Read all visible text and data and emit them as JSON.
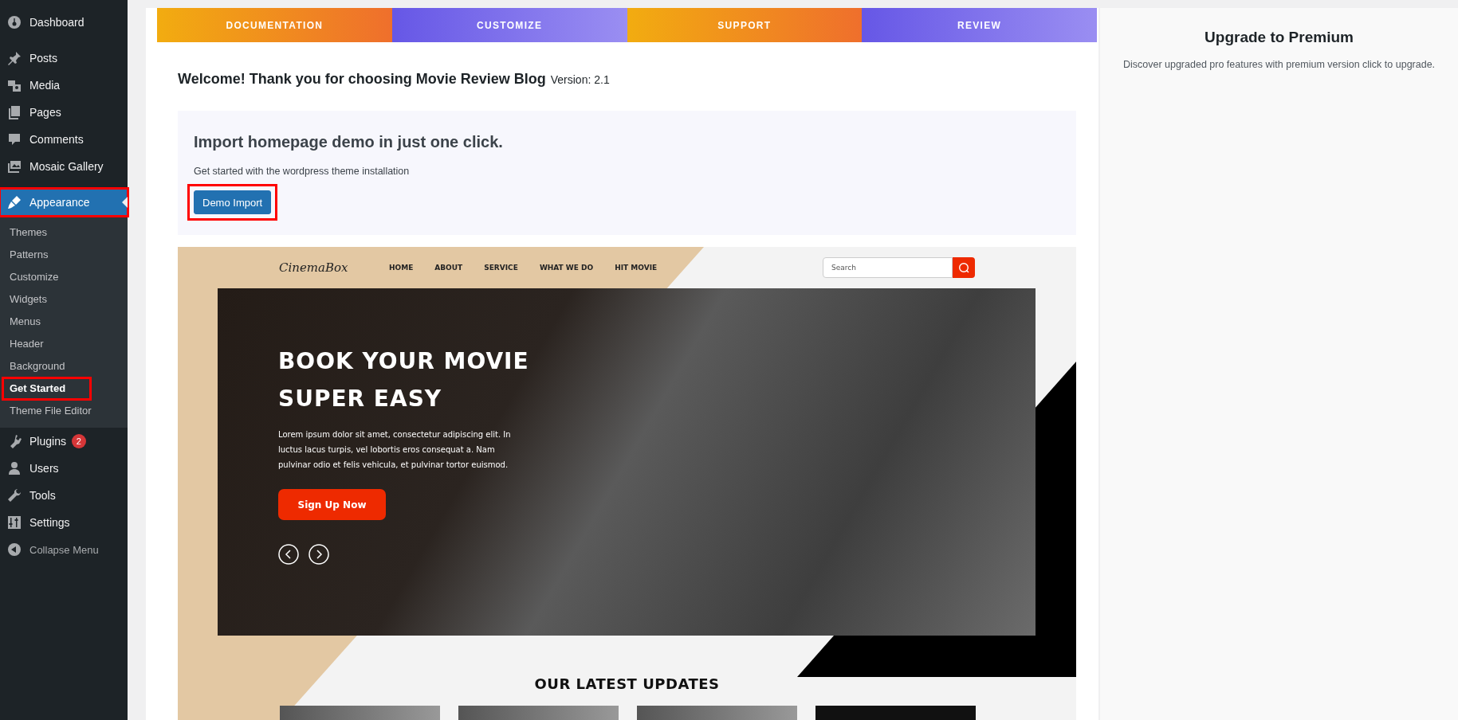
{
  "sidebar": {
    "menu": [
      {
        "label": "Dashboard",
        "selected": false,
        "highlighted": false
      },
      {
        "label": "Posts",
        "selected": false,
        "highlighted": false
      },
      {
        "label": "Media",
        "selected": false,
        "highlighted": false
      },
      {
        "label": "Pages",
        "selected": false,
        "highlighted": false
      },
      {
        "label": "Comments",
        "selected": false,
        "highlighted": false
      },
      {
        "label": "Mosaic Gallery",
        "selected": false,
        "highlighted": false
      },
      {
        "label": "Appearance",
        "selected": true,
        "highlighted": true,
        "submenu": [
          {
            "label": "Themes",
            "selected": false,
            "highlighted": false
          },
          {
            "label": "Patterns",
            "selected": false,
            "highlighted": false
          },
          {
            "label": "Customize",
            "selected": false,
            "highlighted": false
          },
          {
            "label": "Widgets",
            "selected": false,
            "highlighted": false
          },
          {
            "label": "Menus",
            "selected": false,
            "highlighted": false
          },
          {
            "label": "Header",
            "selected": false,
            "highlighted": false
          },
          {
            "label": "Background",
            "selected": false,
            "highlighted": false
          },
          {
            "label": "Get Started",
            "selected": true,
            "highlighted": true
          },
          {
            "label": "Theme File Editor",
            "selected": false,
            "highlighted": false
          }
        ]
      },
      {
        "label": "Plugins",
        "selected": false,
        "highlighted": false,
        "badge": "2"
      },
      {
        "label": "Users",
        "selected": false,
        "highlighted": false
      },
      {
        "label": "Tools",
        "selected": false,
        "highlighted": false
      },
      {
        "label": "Settings",
        "selected": false,
        "highlighted": false
      }
    ],
    "collapse_button": {
      "label": "Collapse Menu"
    }
  },
  "tabs": [
    {
      "label": "DOCUMENTATION",
      "kind": "warm"
    },
    {
      "label": "CUSTOMIZE",
      "kind": "cool"
    },
    {
      "label": "SUPPORT",
      "kind": "warm"
    },
    {
      "label": "REVIEW",
      "kind": "cool"
    }
  ],
  "welcome": {
    "title": "Welcome! Thank you for choosing Movie Review Blog",
    "version": "Version: 2.1"
  },
  "import_box": {
    "title": "Import homepage demo in just one click.",
    "text": "Get started with the wordpress theme installation",
    "button": {
      "label": "Demo Import",
      "highlighted": true
    }
  },
  "preview": {
    "logo": "CinemaBox",
    "nav": [
      "HOME",
      "ABOUT",
      "SERVICE",
      "WHAT WE DO",
      "HIT MOVIE"
    ],
    "search": {
      "placeholder": "Search"
    },
    "hero": {
      "title_lines": [
        "BOOK YOUR MOVIE",
        "SUPER EASY"
      ],
      "text_lines": [
        "Lorem ipsum dolor sit amet, consectetur adipiscing elit. In",
        "luctus lacus turpis, vel lobortis eros consequat a. Nam",
        "pulvinar odio et felis vehicula, et pulvinar tortor euismod."
      ],
      "button": "Sign Up Now"
    },
    "section_title": "OUR LATEST UPDATES"
  },
  "upgrade": {
    "title": "Upgrade to Premium",
    "text": "Discover upgraded pro features with premium version click to upgrade."
  }
}
